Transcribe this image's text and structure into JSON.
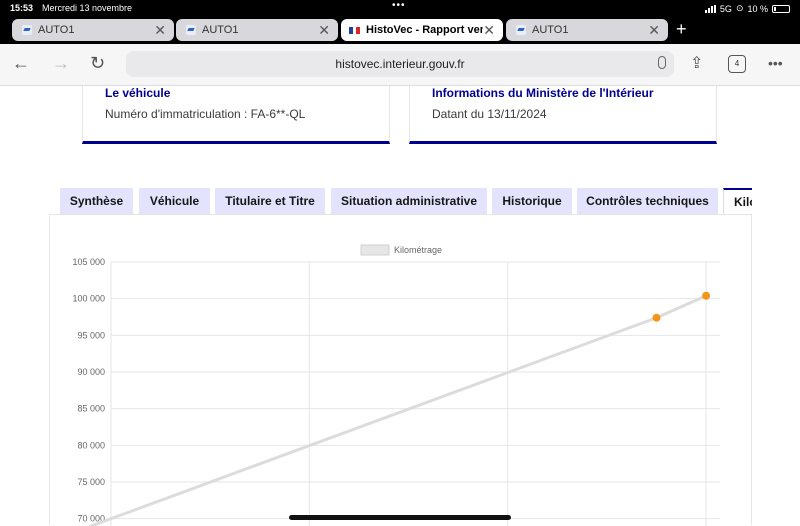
{
  "status": {
    "time": "15:53",
    "date": "Mercredi 13 novembre",
    "network": "5G",
    "battery": "10 %"
  },
  "browser_tabs": [
    {
      "label": "AUTO1",
      "icon": "auto1-favicon"
    },
    {
      "label": "AUTO1",
      "icon": "auto1-favicon"
    },
    {
      "label": "HistoVec - Rapport vendeur",
      "icon": "french-flag-favicon"
    },
    {
      "label": "AUTO1",
      "icon": "auto1-favicon"
    }
  ],
  "toolbar": {
    "url": "histovec.interieur.gouv.fr",
    "tab_count": "4"
  },
  "cards": [
    {
      "title": "Le véhicule",
      "value": "Numéro d'immatriculation : FA-6**-QL"
    },
    {
      "title": "Informations du Ministère de l'Intérieur",
      "value": "Datant du 13/11/2024"
    }
  ],
  "page_tabs": [
    {
      "label": "Synthèse"
    },
    {
      "label": "Véhicule"
    },
    {
      "label": "Titulaire et Titre"
    },
    {
      "label": "Situation administrative"
    },
    {
      "label": "Historique"
    },
    {
      "label": "Contrôles techniques"
    },
    {
      "label": "Kilométrage"
    }
  ],
  "colors": {
    "accent": "#000091",
    "tab_bg": "#e3e3fd",
    "point": "#f39518",
    "line": "#dcdcdc"
  },
  "chart_data": {
    "type": "line",
    "legend": [
      "Kilométrage"
    ],
    "series": [
      {
        "name": "Kilométrage",
        "points": [
          {
            "x": -0.15,
            "y": 68500
          },
          {
            "x": 2.75,
            "y": 97400
          },
          {
            "x": 3.0,
            "y": 100400
          }
        ],
        "markers": [
          1,
          2
        ]
      }
    ],
    "xlim": [
      0,
      3.07
    ],
    "ylim": [
      69000,
      105000
    ],
    "yticks": [
      "105 000",
      "100 000",
      "95 000",
      "90 000",
      "85 000",
      "80 000",
      "75 000",
      "70 000"
    ],
    "ytick_values": [
      105000,
      100000,
      95000,
      90000,
      85000,
      80000,
      75000,
      70000
    ],
    "xgrid": [
      0,
      1,
      2,
      3
    ]
  }
}
